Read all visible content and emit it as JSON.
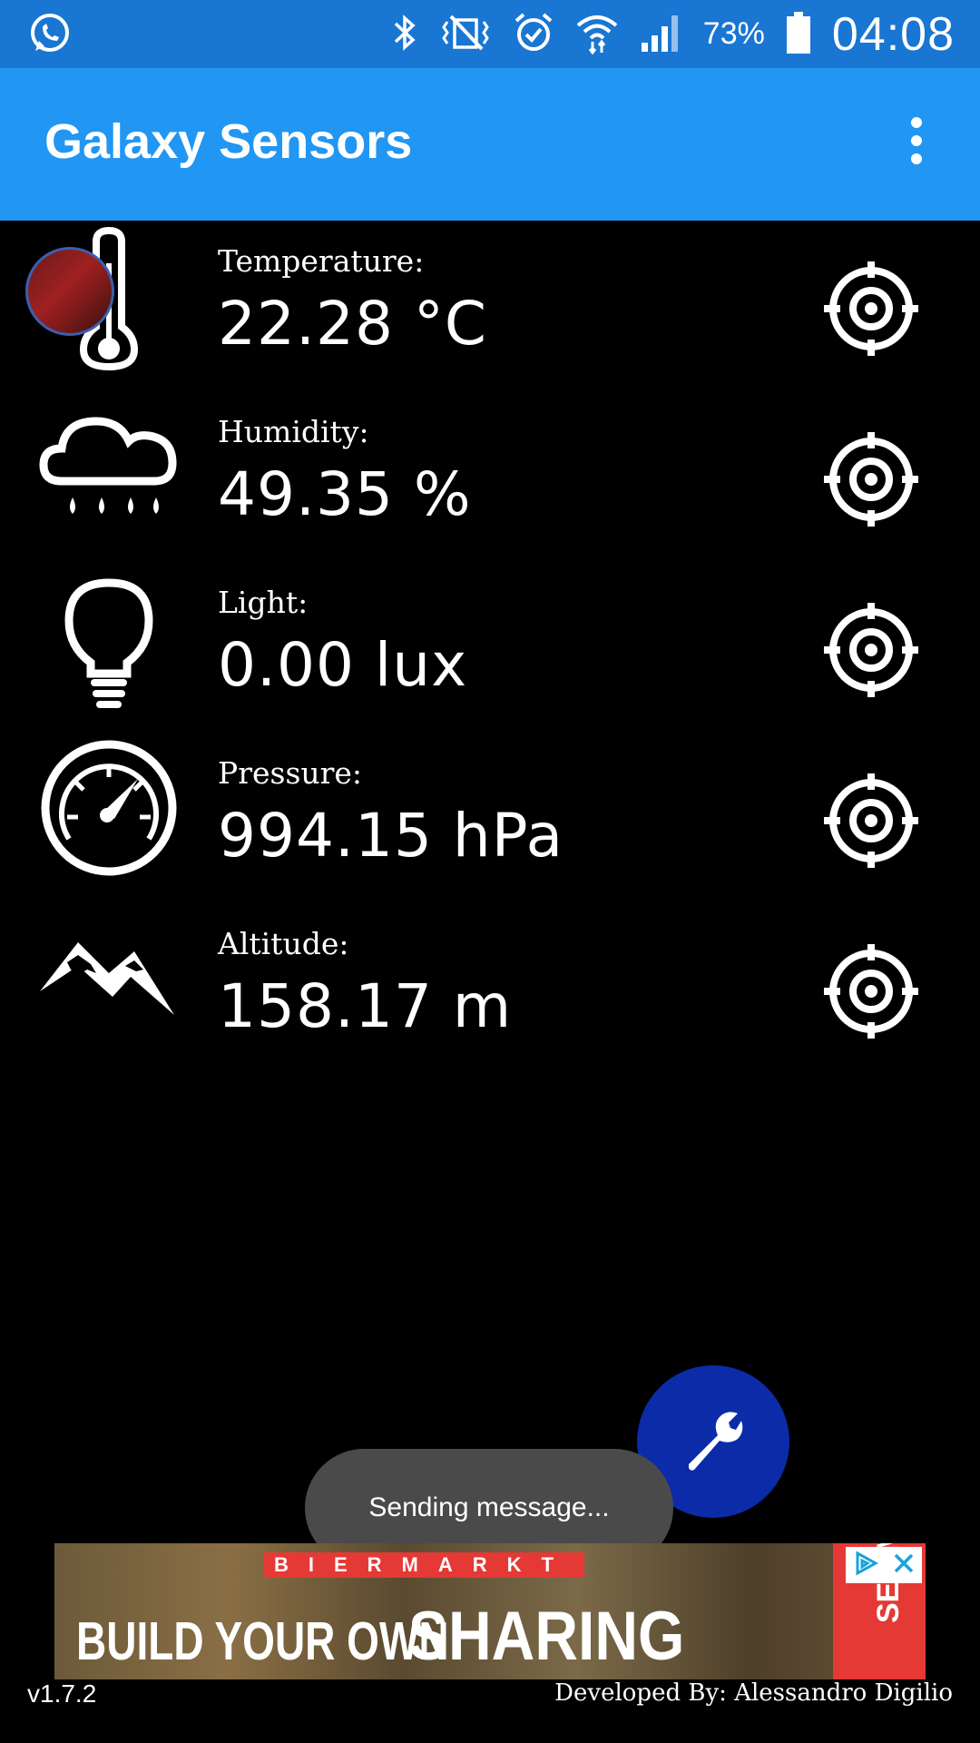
{
  "status_bar": {
    "battery_percent": "73%",
    "time": "04:08",
    "icons": [
      "whatsapp-icon",
      "bluetooth-icon",
      "vibrate-icon",
      "alarm-icon",
      "wifi-icon",
      "signal-icon",
      "battery-icon"
    ]
  },
  "app_bar": {
    "title": "Galaxy Sensors",
    "menu_icon": "overflow-menu-icon"
  },
  "sensors": [
    {
      "label": "Temperature:",
      "value": "22.28 °C",
      "icon": "thermometer-icon"
    },
    {
      "label": "Humidity:",
      "value": "49.35 %",
      "icon": "rain-cloud-icon"
    },
    {
      "label": "Light:",
      "value": "0.00 lux",
      "icon": "lightbulb-icon"
    },
    {
      "label": "Pressure:",
      "value": "994.15 hPa",
      "icon": "gauge-icon"
    },
    {
      "label": "Altitude:",
      "value": "158.17 m",
      "icon": "mountain-icon"
    }
  ],
  "fab": {
    "icon": "wrench-icon"
  },
  "toast": {
    "text": "Sending message..."
  },
  "ad": {
    "brand": "BIERMARKT",
    "small_text": "BUILD YOUR OWN",
    "big_text": "SHARING BOARDS",
    "cta": "SEE ME"
  },
  "footer": {
    "version": "v1.7.2",
    "developer": "Developed By: Alessandro Digilio"
  },
  "colors": {
    "status_bar": "#1976d2",
    "app_bar": "#2196f3",
    "fab": "#0b2ba8",
    "ad_accent": "#e53935"
  }
}
